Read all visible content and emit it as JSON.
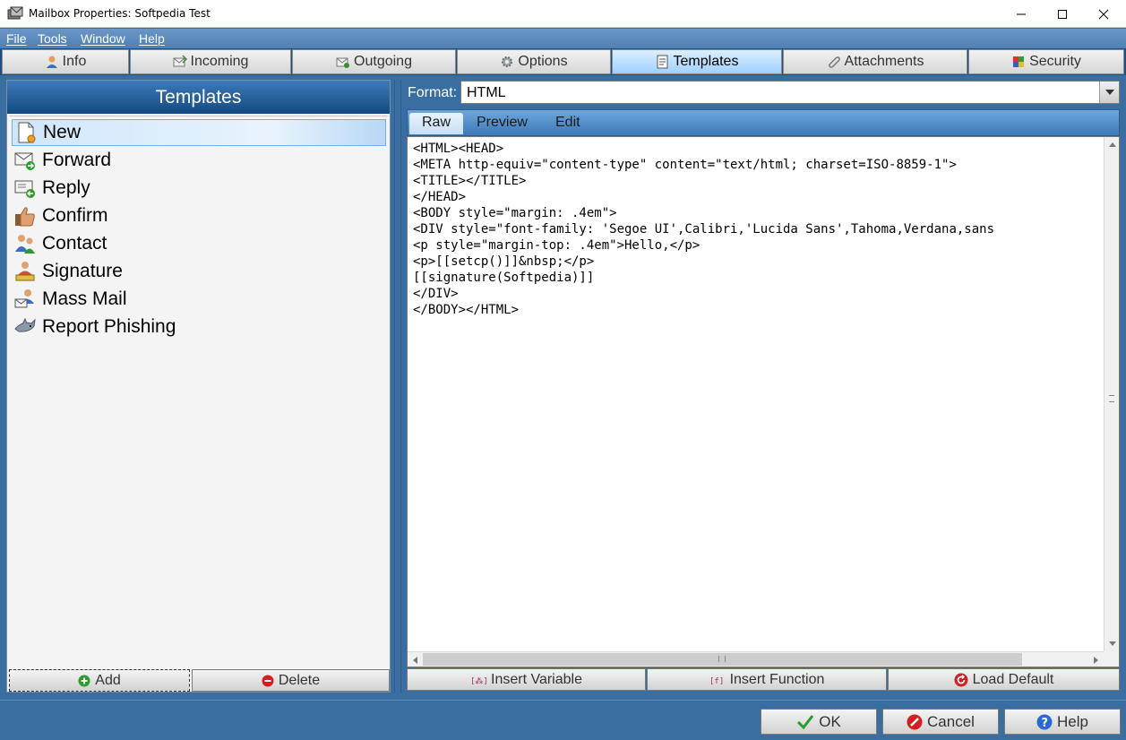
{
  "window": {
    "title": "Mailbox Properties: Softpedia Test"
  },
  "menu": [
    {
      "label": "File"
    },
    {
      "label": "Tools"
    },
    {
      "label": "Window"
    },
    {
      "label": "Help"
    }
  ],
  "tabs": [
    {
      "label": "Info",
      "icon": "user-icon"
    },
    {
      "label": "Incoming",
      "icon": "incoming-mail-icon"
    },
    {
      "label": "Outgoing",
      "icon": "outgoing-mail-icon"
    },
    {
      "label": "Options",
      "icon": "gear-icon"
    },
    {
      "label": "Templates",
      "icon": "template-icon",
      "active": true
    },
    {
      "label": "Attachments",
      "icon": "paperclip-icon"
    },
    {
      "label": "Security",
      "icon": "shield-icon"
    }
  ],
  "templates": {
    "header": "Templates",
    "items": [
      {
        "label": "New",
        "icon": "new-document-icon",
        "selected": true
      },
      {
        "label": "Forward",
        "icon": "forward-mail-icon"
      },
      {
        "label": "Reply",
        "icon": "reply-mail-icon"
      },
      {
        "label": "Confirm",
        "icon": "thumbs-up-icon"
      },
      {
        "label": "Contact",
        "icon": "contact-icon"
      },
      {
        "label": "Signature",
        "icon": "signature-stamp-icon"
      },
      {
        "label": "Mass Mail",
        "icon": "mass-mail-icon"
      },
      {
        "label": "Report Phishing",
        "icon": "shark-icon"
      }
    ],
    "add_label": "Add",
    "delete_label": "Delete"
  },
  "format": {
    "label": "Format:",
    "value": "HTML"
  },
  "editor_tabs": [
    {
      "label": "Raw",
      "active": true
    },
    {
      "label": "Preview"
    },
    {
      "label": "Edit"
    }
  ],
  "editor": {
    "lines": [
      "<HTML><HEAD>",
      "<META http-equiv=\"content-type\" content=\"text/html; charset=ISO-8859-1\">",
      "<TITLE></TITLE>",
      "</HEAD>",
      "<BODY style=\"margin: .4em\">",
      "<DIV style=\"font-family: 'Segoe UI',Calibri,'Lucida Sans',Tahoma,Verdana,sans",
      "<p style=\"margin-top: .4em\">Hello,</p>",
      "<p>[[setcp()]]&nbsp;</p>",
      "[[signature(Softpedia)]]",
      "</DIV>",
      "</BODY></HTML>"
    ]
  },
  "editor_buttons": {
    "insert_variable": "Insert Variable",
    "insert_function": "Insert Function",
    "load_default": "Load Default"
  },
  "dialog_buttons": {
    "ok": "OK",
    "cancel": "Cancel",
    "help": "Help"
  },
  "colors": {
    "background": "#3a6ea0",
    "active_tab": "#9fd0ff",
    "header": "#134a82"
  }
}
